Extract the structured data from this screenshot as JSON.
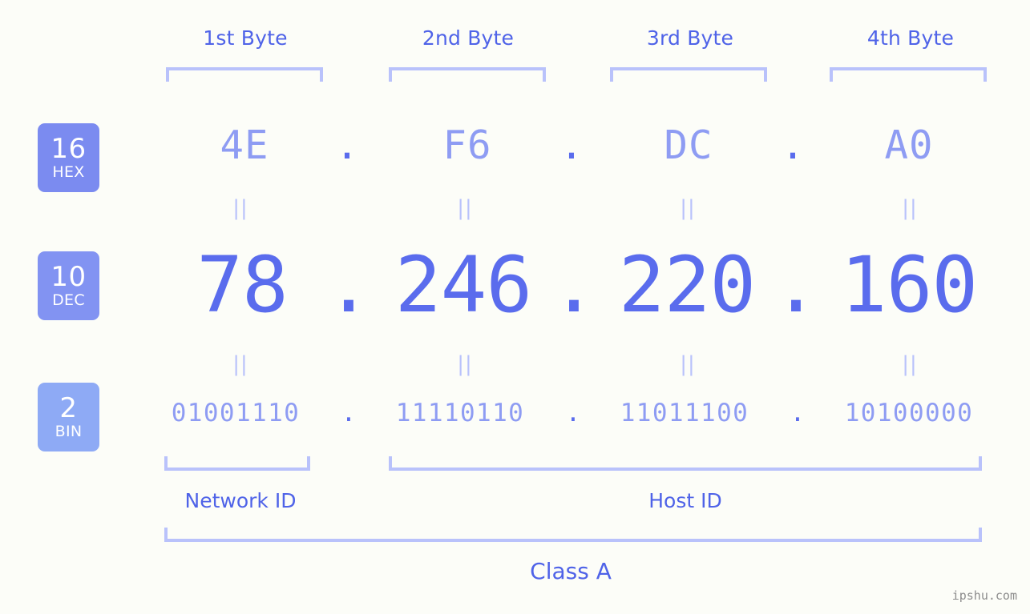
{
  "background_color": "#fcfdf8",
  "accent_colors": {
    "header_text": "#4f63e8",
    "bracket": "#b9c2fb",
    "hex_value": "#8e9cf3",
    "dec_value": "#5a6ced",
    "bin_value": "#8e9cf3",
    "badge_hex": "#7b8bf0",
    "badge_dec": "#8293f2",
    "badge_bin": "#8eaaf5",
    "watermark": "#8c8c8c"
  },
  "byte_headers": [
    {
      "label": "1st Byte"
    },
    {
      "label": "2nd Byte"
    },
    {
      "label": "3rd Byte"
    },
    {
      "label": "4th Byte"
    }
  ],
  "radix_badges": [
    {
      "number": "16",
      "name": "HEX"
    },
    {
      "number": "10",
      "name": "DEC"
    },
    {
      "number": "2",
      "name": "BIN"
    }
  ],
  "rows": {
    "hex": {
      "values": [
        "4E",
        "F6",
        "DC",
        "A0"
      ]
    },
    "dec": {
      "values": [
        "78",
        "246",
        "220",
        "160"
      ]
    },
    "bin": {
      "values": [
        "01001110",
        "11110110",
        "11011100",
        "10100000"
      ]
    }
  },
  "separator": ".",
  "equality_mark": "||",
  "id_sections": [
    {
      "label": "Network ID"
    },
    {
      "label": "Host ID"
    }
  ],
  "class_label": "Class A",
  "watermark": "ipshu.com"
}
